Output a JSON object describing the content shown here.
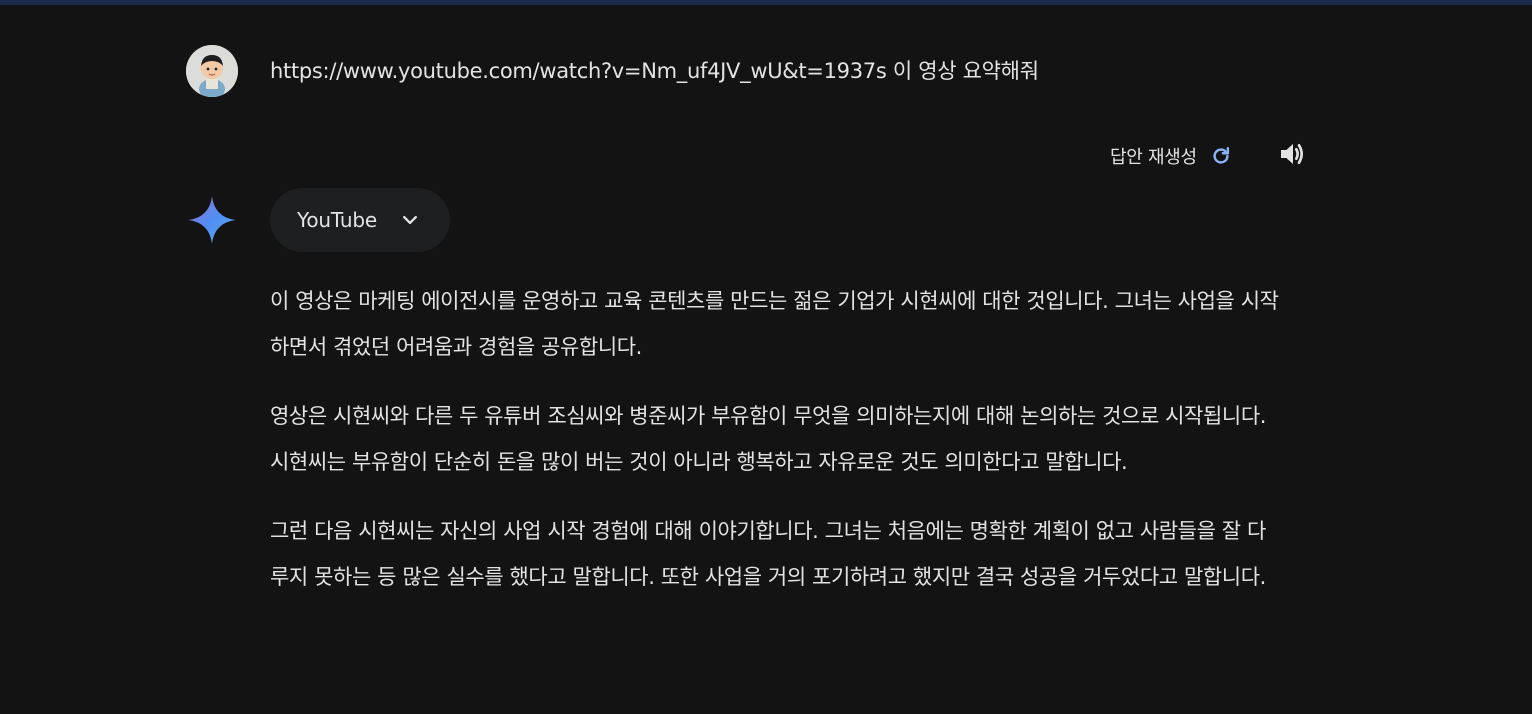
{
  "user_prompt": {
    "avatar": "user-avatar",
    "text": "https://www.youtube.com/watch?v=Nm_uf4JV_wU&t=1937s 이 영상 요약해줘"
  },
  "actions": {
    "regenerate_label": "답안 재생성",
    "regenerate_icon": "refresh-icon",
    "speaker_icon": "speaker-icon"
  },
  "response": {
    "model_icon": "sparkle-icon",
    "extension_chip": {
      "label": "YouTube",
      "icon": "chevron-down-icon"
    },
    "paragraphs": [
      "이 영상은 마케팅 에이전시를 운영하고 교육 콘텐츠를 만드는 젊은 기업가 시현씨에 대한 것입니다. 그녀는 사업을 시작하면서 겪었던 어려움과 경험을 공유합니다.",
      "영상은 시현씨와 다른 두 유튜버 조심씨와 병준씨가 부유함이 무엇을 의미하는지에 대해 논의하는 것으로 시작됩니다. 시현씨는 부유함이 단순히 돈을 많이 버는 것이 아니라 행복하고 자유로운 것도 의미한다고 말합니다.",
      "그런 다음 시현씨는 자신의 사업 시작 경험에 대해 이야기합니다. 그녀는 처음에는 명확한 계획이 없고 사람들을 잘 다루지 못하는 등 많은 실수를 했다고 말합니다. 또한 사업을 거의 포기하려고 했지만 결국 성공을 거두었다고 말합니다."
    ]
  },
  "colors": {
    "background": "#131314",
    "text": "#e3e3e3",
    "chip_bg": "#1e1f20",
    "accent_blue": "#8ab4f8"
  }
}
